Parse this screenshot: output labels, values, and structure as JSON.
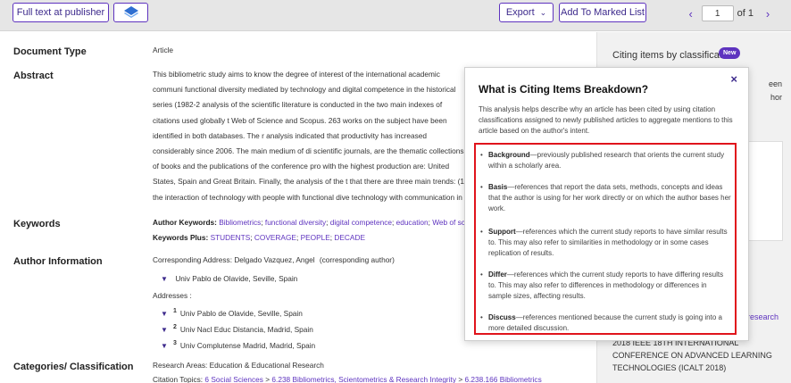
{
  "toolbar": {
    "fulltext_label": "Full text at publisher",
    "export_label": "Export",
    "marked_label": "Add To Marked List",
    "page_value": "1",
    "page_of": "of 1"
  },
  "record": {
    "doc_type_label": "Document Type",
    "doc_type_value": "Article",
    "abstract_label": "Abstract",
    "abstract_text": "This bibliometric study aims to know the degree of interest of the international academic communi functional diversity mediated by technology and digital competence in the historical series (1982-2 analysis of the scientific literature is conducted in the two main indexes of citations used globally t Web of Science and Scopus. 263 works on the subject have been identified in both databases. The r analysis indicated that productivity has increased considerably since 2006. The main medium of di scientific journals, are the thematic collections of books and the publications of the conference pro with the highest production are: United States, Spain and Great Britain. Finally, the analysis of the t that there are three main trends: (1) the interaction of technology with people with functional dive technology with communication in people with functional diversity and (3) the relationship betwee competence.",
    "keywords_label": "Keywords",
    "author_kw_label": "Author Keywords:",
    "author_keywords": [
      "Bibliometrics",
      "functional diversity",
      "digital competence",
      "education",
      "Web of scien"
    ],
    "kw_plus_label": "Keywords Plus:",
    "keywords_plus": [
      "STUDENTS",
      "COVERAGE",
      "PEOPLE",
      "DECADE"
    ],
    "author_info_label": "Author Information",
    "corr_address": "Corresponding Address: Delgado Vazquez, Angel",
    "corr_author": "(corresponding author)",
    "corr_affil": "Univ Pablo de Olavide, Seville, Spain",
    "addresses_label": "Addresses :",
    "addresses": [
      {
        "num": "1",
        "text": "Univ Pablo de Olavide, Seville, Spain"
      },
      {
        "num": "2",
        "text": "Univ Nacl Educ Distancia, Madrid, Spain"
      },
      {
        "num": "3",
        "text": "Univ Complutense Madrid, Madrid, Spain"
      }
    ],
    "categories_label": "Categories/ Classification",
    "research_areas": "Research Areas: Education & Educational Research",
    "citation_topics_label": "Citation Topics:",
    "citation_topics": [
      "6 Social Sciences",
      "6.238 Bibliometrics, Scientometrics & Research Integrity",
      "6.238.166 Bibliometrics"
    ],
    "topic_sep": ">"
  },
  "rail": {
    "title": "Citing items by classification",
    "new_badge": "New",
    "partial_1": "een",
    "partial_2": "hor",
    "partial_3": "research",
    "conference": "2018 IEEE 18TH INTERNATIONAL CONFERENCE ON ADVANCED LEARNING TECHNOLOGIES (ICALT 2018)"
  },
  "popover": {
    "title": "What is Citing Items Breakdown?",
    "close": "×",
    "intro": "This analysis helps describe why an article has been cited by using citation classifications assigned to newly published articles to aggregate mentions to this article based on the author's intent.",
    "items": [
      {
        "term": "Background",
        "desc": "—previously published research that orients the current study within a scholarly area."
      },
      {
        "term": "Basis",
        "desc": "—references that report the data sets, methods, concepts and ideas that the author is using for her work directly or on which the author bases her work."
      },
      {
        "term": "Support",
        "desc": "—references which the current study reports to have similar results to. This may also refer to similarities in methodology or in some cases replication of results."
      },
      {
        "term": "Differ",
        "desc": "—references which the current study reports to have differing results to. This may also refer to differences in methodology or differences in sample sizes, affecting results."
      },
      {
        "term": "Discuss",
        "desc": "—references mentioned because the current study is going into a more detailed discussion."
      }
    ]
  },
  "colors": {
    "accent": "#5e33bf",
    "highlight_box": "#e0141c"
  },
  "icons": {
    "toolbar_icon": "stack-layers-icon",
    "export_caret": "chevron-down-icon",
    "prev": "chevron-left-icon",
    "next": "chevron-right-icon"
  }
}
